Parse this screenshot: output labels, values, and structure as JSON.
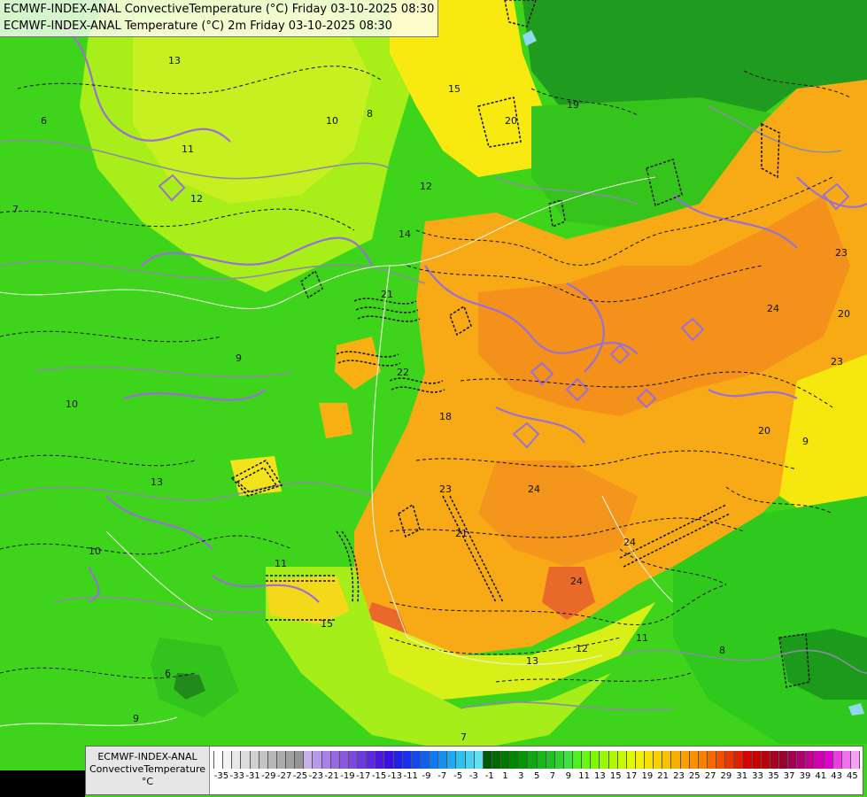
{
  "title_lines": [
    "ECMWF-INDEX-ANAL ConvectiveTemperature (°C) Friday 03-10-2025 08:30",
    "ECMWF-INDEX-ANAL Temperature (°C) 2m Friday 03-10-2025 08:30"
  ],
  "legend": {
    "source": "ECMWF-INDEX-ANAL",
    "parameter": "ConvectiveTemperature",
    "unit": "°C",
    "tick_labels": [
      "-35",
      "-33",
      "-31",
      "-29",
      "-27",
      "-25",
      "-23",
      "-21",
      "-19",
      "-17",
      "-15",
      "-13",
      "-11",
      "-9",
      "-7",
      "-5",
      "-3",
      "-1",
      "1",
      "3",
      "5",
      "7",
      "9",
      "11",
      "13",
      "15",
      "17",
      "19",
      "21",
      "23",
      "25",
      "27",
      "29",
      "31",
      "33",
      "35",
      "37",
      "39",
      "41",
      "43",
      "45"
    ],
    "colors": [
      "#ffffff",
      "#f4f4f4",
      "#e8e8e8",
      "#dcdcdc",
      "#d0d0d0",
      "#c4c4c4",
      "#b8b8b8",
      "#acacac",
      "#a0a0a0",
      "#949494",
      "#c8b0e8",
      "#b898e8",
      "#a880e8",
      "#9868e0",
      "#8c58e0",
      "#7c48e0",
      "#6c38e0",
      "#5c28e0",
      "#4c18e0",
      "#3c10e0",
      "#2020e8",
      "#1830f0",
      "#1448f0",
      "#1060f0",
      "#1078f0",
      "#1890f0",
      "#20a8f0",
      "#30c0f0",
      "#48d0f0",
      "#60e0f0",
      "#005800",
      "#006800",
      "#007800",
      "#008800",
      "#009800",
      "#10a810",
      "#18b818",
      "#20c020",
      "#30d030",
      "#40e040",
      "#50f020",
      "#68f810",
      "#80f800",
      "#98f800",
      "#b0f800",
      "#c8f800",
      "#e0f800",
      "#f0f000",
      "#f8e000",
      "#f8d000",
      "#f8c000",
      "#f8b000",
      "#f8a000",
      "#f89000",
      "#f88000",
      "#f86800",
      "#f05000",
      "#e83800",
      "#e02000",
      "#d80000",
      "#c80000",
      "#b80010",
      "#a80020",
      "#980030",
      "#a00050",
      "#b00070",
      "#c00090",
      "#d000b0",
      "#e000d0",
      "#e840e0",
      "#f070f0",
      "#f8a0f8"
    ]
  },
  "contour_labels": [
    {
      "text": "13"
    },
    {
      "text": "12"
    },
    {
      "text": "11"
    },
    {
      "text": "10"
    },
    {
      "text": "9"
    },
    {
      "text": "8"
    },
    {
      "text": "7"
    },
    {
      "text": "6"
    },
    {
      "text": "15"
    },
    {
      "text": "20"
    },
    {
      "text": "23"
    },
    {
      "text": "24"
    },
    {
      "text": "12"
    },
    {
      "text": "14"
    },
    {
      "text": "21"
    },
    {
      "text": "22"
    },
    {
      "text": "18"
    },
    {
      "text": "19"
    },
    {
      "text": "13"
    },
    {
      "text": "10"
    },
    {
      "text": "9"
    },
    {
      "text": "15"
    },
    {
      "text": "24"
    },
    {
      "text": "20"
    },
    {
      "text": "23"
    },
    {
      "text": "20"
    },
    {
      "text": "21"
    },
    {
      "text": "9"
    },
    {
      "text": "13"
    },
    {
      "text": "11"
    },
    {
      "text": "7"
    },
    {
      "text": "8"
    },
    {
      "text": "10"
    },
    {
      "text": "6"
    },
    {
      "text": "24"
    },
    {
      "text": "23"
    },
    {
      "text": "24"
    },
    {
      "text": "12"
    },
    {
      "text": "11"
    }
  ],
  "colors": {
    "low_green": "#2ec81a",
    "mid_green": "#52e01e",
    "lime": "#8ef01a",
    "yellow_green": "#c2f01a",
    "yellow": "#f8e800",
    "orange_light": "#f8c010",
    "orange": "#f8a814",
    "orange_dark": "#f08a18",
    "red_orange": "#e86028",
    "dark_green": "#1a9a1a",
    "contour_purple": "#9a70d8",
    "contour_gray": "#8a8aa0"
  }
}
